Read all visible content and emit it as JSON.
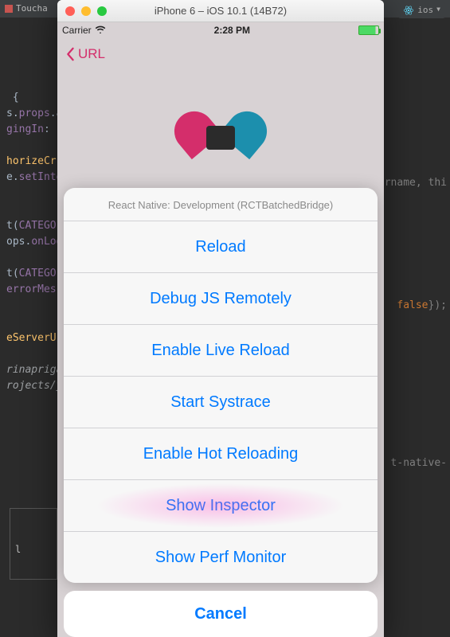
{
  "ide": {
    "tab_label": "Toucha",
    "run_config": "ios",
    "code_lines": [
      " {",
      "s.props.a",
      "gingIn: ",
      "",
      "horizeCr",
      "e.setInte",
      "",
      "",
      "t(CATEGO",
      "ops.onLog",
      "",
      "t(CATEGO",
      "errorMes",
      "",
      "",
      "eServerUr",
      "",
      "rinapriga",
      "rojects/ye"
    ],
    "right_snippets": {
      "rname": "rname, thi",
      "false": "false});",
      "native": "t-native-"
    },
    "console_char": "l"
  },
  "simulator": {
    "window_title": "iPhone 6 – iOS 10.1 (14B72)"
  },
  "status_bar": {
    "carrier": "Carrier",
    "time": "2:28 PM"
  },
  "nav": {
    "back_label": "URL"
  },
  "action_sheet": {
    "title": "React Native: Development (RCTBatchedBridge)",
    "items": [
      "Reload",
      "Debug JS Remotely",
      "Enable Live Reload",
      "Start Systrace",
      "Enable Hot Reloading",
      "Show Inspector",
      "Show Perf Monitor"
    ],
    "highlight_index": 5,
    "cancel_label": "Cancel"
  }
}
